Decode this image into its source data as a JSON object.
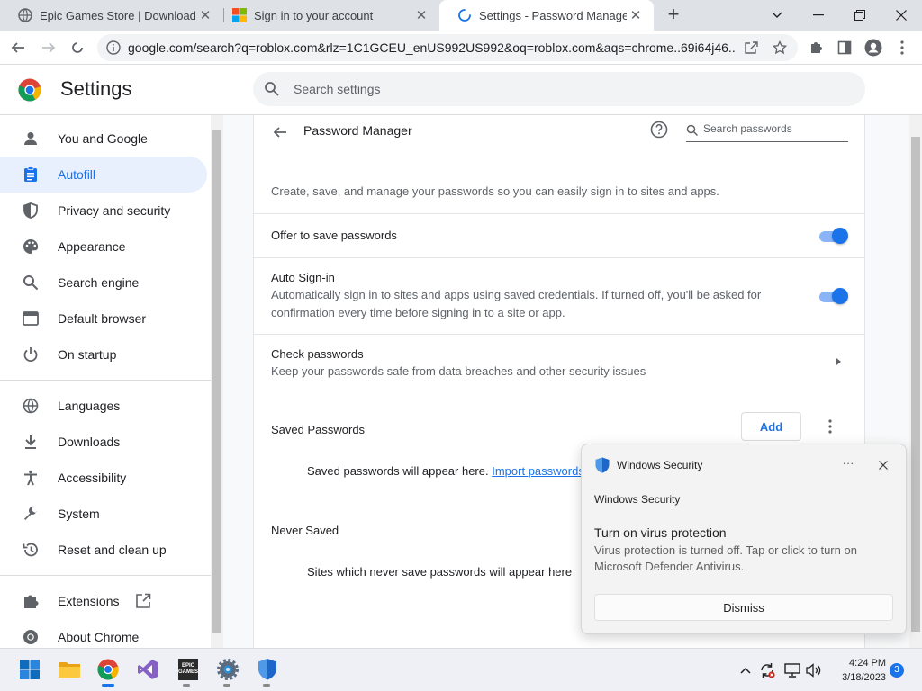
{
  "browser": {
    "tabs": [
      {
        "title": "Epic Games Store | Download & Play",
        "icon": "globe-icon",
        "active": false
      },
      {
        "title": "Sign in to your account",
        "icon": "microsoft-logo-icon",
        "active": false
      },
      {
        "title": "Settings - Password Manager",
        "icon": "loading-spinner-icon",
        "active": true
      }
    ],
    "url": "google.com/search?q=roblox.com&rlz=1C1GCEU_enUS992US992&oq=roblox.com&aqs=chrome..69i64j46..."
  },
  "settings": {
    "title": "Settings",
    "search_placeholder": "Search settings"
  },
  "sidebar": {
    "items": [
      {
        "label": "You and Google",
        "icon": "person-icon"
      },
      {
        "label": "Autofill",
        "icon": "autofill-icon",
        "active": true
      },
      {
        "label": "Privacy and security",
        "icon": "shield-icon"
      },
      {
        "label": "Appearance",
        "icon": "palette-icon"
      },
      {
        "label": "Search engine",
        "icon": "search-icon"
      },
      {
        "label": "Default browser",
        "icon": "browser-icon"
      },
      {
        "label": "On startup",
        "icon": "power-icon"
      },
      {
        "label": "Languages",
        "icon": "globe-icon"
      },
      {
        "label": "Downloads",
        "icon": "download-icon"
      },
      {
        "label": "Accessibility",
        "icon": "accessibility-icon"
      },
      {
        "label": "System",
        "icon": "wrench-icon"
      },
      {
        "label": "Reset and clean up",
        "icon": "history-icon"
      },
      {
        "label": "Extensions",
        "icon": "puzzle-icon"
      },
      {
        "label": "About Chrome",
        "icon": "chrome-icon"
      }
    ]
  },
  "password_manager": {
    "title": "Password Manager",
    "search_placeholder": "Search passwords",
    "intro": "Create, save, and manage your passwords so you can easily sign in to sites and apps.",
    "offer_to_save": {
      "label": "Offer to save passwords",
      "enabled": true
    },
    "auto_signin": {
      "label": "Auto Sign-in",
      "description": "Automatically sign in to sites and apps using saved credentials. If turned off, you'll be asked for confirmation every time before signing in to a site or app.",
      "enabled": true
    },
    "check_passwords": {
      "label": "Check passwords",
      "description": "Keep your passwords safe from data breaches and other security issues"
    },
    "saved_passwords": {
      "title": "Saved Passwords",
      "add_label": "Add",
      "empty_text": "Saved passwords will appear here.",
      "import_link": "Import passwords"
    },
    "never_saved": {
      "title": "Never Saved",
      "empty_text": "Sites which never save passwords will appear here"
    }
  },
  "toast": {
    "app_name": "Windows Security",
    "more_label": "···",
    "attribution": "Windows Security",
    "headline": "Turn on virus protection",
    "body": "Virus protection is turned off. Tap or click to turn on Microsoft Defender Antivirus.",
    "dismiss_label": "Dismiss"
  },
  "taskbar": {
    "apps": [
      "start-icon",
      "file-explorer-icon",
      "chrome-icon",
      "visual-studio-icon",
      "epic-games-icon",
      "settings-gear-icon",
      "windows-security-icon"
    ],
    "epic_label": "EPIC\nGAMES",
    "time": "4:24 PM",
    "date": "3/18/2023",
    "notification_count": "3"
  }
}
